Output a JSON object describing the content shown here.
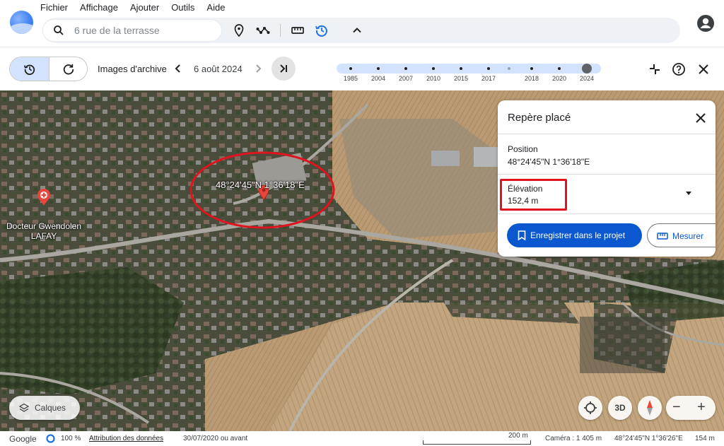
{
  "menu": {
    "items": [
      "Fichier",
      "Affichage",
      "Ajouter",
      "Outils",
      "Aide"
    ]
  },
  "search": {
    "value": "6 rue de la terrasse"
  },
  "toolbar": {
    "icons": [
      "place-marker-icon",
      "path-icon",
      "ruler-icon",
      "history-icon",
      "chevron-up-icon"
    ],
    "accent": "#1a73e8"
  },
  "archive": {
    "label": "Images d'archive",
    "date": "6 août 2024",
    "timeline_years": [
      "1985",
      "2004",
      "2007",
      "2010",
      "2015",
      "2017",
      "",
      "2018",
      "2020",
      "2024"
    ]
  },
  "map": {
    "coordinate_label": "48°24'45\"N 1°36'18\"E",
    "poi": {
      "line1": "Docteur Gwendolen",
      "line2": "LAFAY"
    },
    "annotation_color": "#e0141e"
  },
  "panel": {
    "title": "Repère placé",
    "position_label": "Position",
    "position_value": "48°24'45\"N 1°36'18\"E",
    "elevation_label": "Élévation",
    "elevation_value": "152,4 m",
    "save_button": "Enregistrer dans le projet",
    "measure_button": "Mesurer"
  },
  "controls": {
    "layers_button": "Calques",
    "view_3d": "3D",
    "zoom_out": "−",
    "zoom_in": "+"
  },
  "statusbar": {
    "brand": "Google",
    "loading": "100 %",
    "attribution": "Attribution des données",
    "imagery_date": "30/07/2020 ou avant",
    "scale": "200 m",
    "camera": "Caméra : 1 405 m",
    "cursor_coords": "48°24'45\"N 1°36'26\"E",
    "cursor_elevation": "154 m"
  }
}
